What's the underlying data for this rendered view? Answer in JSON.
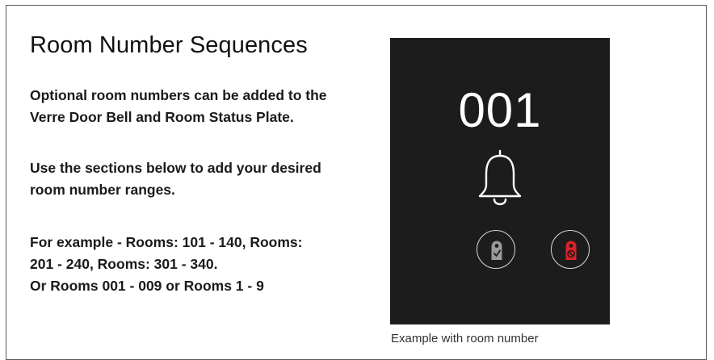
{
  "section": {
    "title": "Room Number Sequences",
    "paragraph1": [
      "Optional room numbers can be added to the",
      "Verre Door Bell and Room Status Plate."
    ],
    "paragraph2": [
      "Use the sections below to add your desired",
      "room number ranges."
    ],
    "paragraph3": [
      "For example - Rooms: 101 - 140, Rooms:",
      "201 - 240, Rooms: 301 - 340.",
      "Or Rooms 001 - 009 or Rooms 1 - 9"
    ]
  },
  "preview": {
    "room_number": "001",
    "caption": "Example with room number",
    "icons": [
      "bell-icon",
      "room-available-hanger-icon",
      "do-not-disturb-hanger-icon"
    ],
    "colors": {
      "panel_background": "#1c1c1c",
      "foreground": "#ffffff",
      "available_icon": "#9a9a9a",
      "dnd_icon": "#e0202a"
    }
  }
}
